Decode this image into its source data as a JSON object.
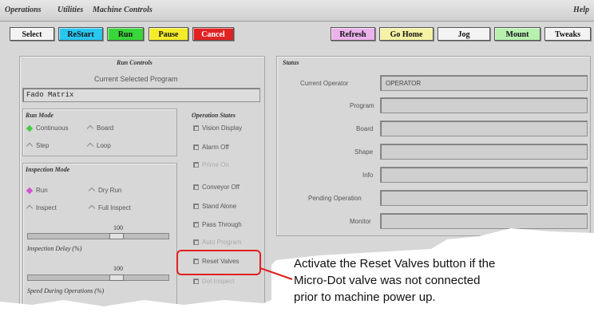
{
  "menubar": {
    "items": [
      "Operations",
      "Utilities",
      "Machine Controls"
    ],
    "help": "Help"
  },
  "toolbar": {
    "select": "Select",
    "restart": "ReStart",
    "run": "Run",
    "pause": "Pause",
    "cancel": "Cancel",
    "refresh": "Refresh",
    "go_home": "Go Home",
    "jog": "Jog",
    "mount": "Mount",
    "tweaks": "Tweaks"
  },
  "colors": {
    "restart": "#29c6ef",
    "run": "#38d638",
    "pause": "#f4ec2a",
    "cancel": "#e02222",
    "refresh": "#ecb2ec",
    "go_home": "#f4f2a4",
    "mount": "#b8f0b0",
    "highlight": "#e02020"
  },
  "run_controls": {
    "title": "Run Controls",
    "current_program_label": "Current Selected Program",
    "program_value": "Fado Matrix",
    "run_mode": {
      "title": "Run Mode",
      "options": [
        "Continuous",
        "Board",
        "Step",
        "Loop"
      ],
      "selected": "Continuous"
    },
    "inspection_mode": {
      "title": "Inspection Mode",
      "options": [
        "Run",
        "Dry Run",
        "Inspect",
        "Full Inspect"
      ],
      "selected": "Run",
      "inspection_delay": {
        "value": "100",
        "label": "Inspection Delay (%)"
      },
      "speed": {
        "value": "100",
        "label": "Speed During Operations (%)"
      }
    },
    "operation_states": {
      "title": "Operation States",
      "items": [
        "Vision Display",
        "Alarm Off",
        "Prime On",
        "Conveyor Off",
        "Stand Alone",
        "Pass Through",
        "Auto Program",
        "Reset Valves",
        "Dot Inspect"
      ]
    }
  },
  "status": {
    "title": "Status",
    "fields": [
      {
        "label": "Current Operator",
        "value": "OPERATOR"
      },
      {
        "label": "Program",
        "value": ""
      },
      {
        "label": "Board",
        "value": ""
      },
      {
        "label": "Shape",
        "value": ""
      },
      {
        "label": "Info",
        "value": ""
      },
      {
        "label": "Pending Operation",
        "value": ""
      },
      {
        "label": "Monitor",
        "value": ""
      }
    ]
  },
  "callout": {
    "lines": [
      "Activate the Reset Valves button if the",
      "Micro-Dot valve was not connected",
      "prior to machine power up."
    ]
  }
}
